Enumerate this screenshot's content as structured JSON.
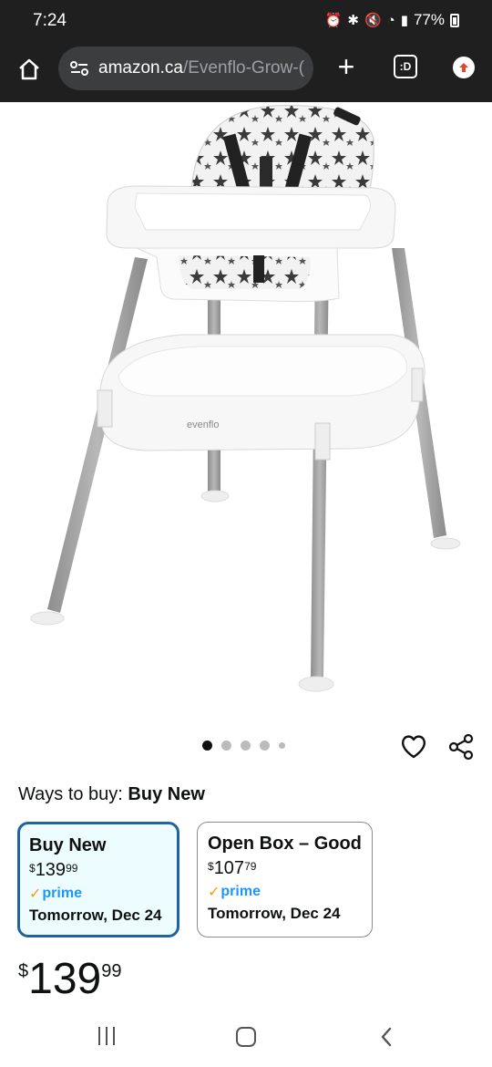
{
  "status_bar": {
    "time": "7:24",
    "battery": "77%"
  },
  "browser": {
    "url_domain": "amazon.ca",
    "url_path": "/Evenflo-Grow-(",
    "tabs_label": ":D"
  },
  "product": {
    "image_alt": "evenflo high chair with star pattern",
    "brand_mark": "evenflo",
    "carousel_count": 5,
    "carousel_active": 0
  },
  "ways_to_buy": {
    "label": "Ways to buy: ",
    "selected": "Buy New",
    "options": [
      {
        "title": "Buy New",
        "price_symbol": "$",
        "price_whole": "139",
        "price_cents": "99",
        "prime": "prime",
        "delivery": "Tomorrow, Dec 24"
      },
      {
        "title": "Open Box – Good",
        "price_symbol": "$",
        "price_whole": "107",
        "price_cents": "79",
        "prime": "prime",
        "delivery": "Tomorrow, Dec 24"
      }
    ]
  },
  "price": {
    "symbol": "$",
    "whole": "139",
    "cents": "99"
  },
  "colors": {
    "accent_blue": "#2162a1",
    "prime_blue": "#1a98ff",
    "prime_orange": "#ff9900",
    "selected_bg": "#edfdff"
  }
}
